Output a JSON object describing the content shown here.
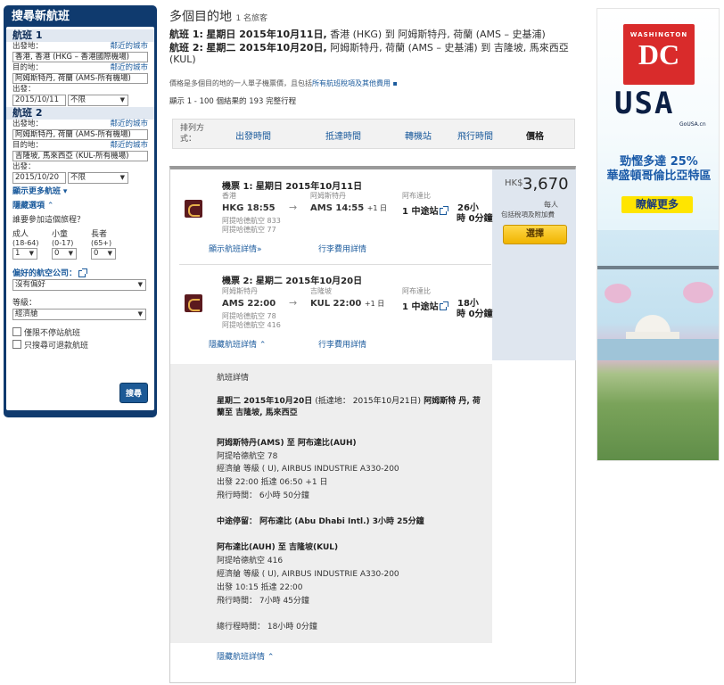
{
  "sidebar": {
    "title": "搜尋新航班",
    "flight1": {
      "header": "航班 1",
      "from_label": "出發地：",
      "from_nearby": "鄰近的城市",
      "from_value": "香港, 香港 (HKG – 香港國際機場)",
      "to_label": "目的地：",
      "to_nearby": "鄰近的城市",
      "to_value": "阿姆斯特丹, 荷蘭 (AMS-所有機場)",
      "depart_label": "出發：",
      "date": "2015/10/11",
      "time": "不限"
    },
    "flight2": {
      "header": "航班 2",
      "from_label": "出發地：",
      "from_nearby": "鄰近的城市",
      "from_value": "阿姆斯特丹, 荷蘭 (AMS-所有機場)",
      "to_label": "目的地：",
      "to_nearby": "鄰近的城市",
      "to_value": "吉隆坡, 馬來西亞 (KUL-所有機場)",
      "depart_label": "出發：",
      "date": "2015/10/20",
      "time": "不限"
    },
    "more_flights": "顯示更多航班",
    "hide_options": "隱藏選項",
    "travelers_q": "誰要參加這個旅程？",
    "adult_label": "成人",
    "adult_range": "(18-64)",
    "adult_value": "1",
    "child_label": "小童",
    "child_range": "(0-17)",
    "child_value": "0",
    "senior_label": "長者",
    "senior_range": "(65+)",
    "senior_value": "0",
    "airline_label": "偏好的航空公司：",
    "airline_value": "沒有偏好",
    "class_label": "等級：",
    "class_value": "經濟艙",
    "nonstop_label": "僅限不停站航班",
    "refundable_label": "只搜尋可退款航班",
    "search_button": "搜尋"
  },
  "header": {
    "title": "多個目的地",
    "travelers": "1 名旅客",
    "route1_prefix": "航班 1:",
    "route1_date": "星期日 2015年10月11日,",
    "route1_text": "香港 (HKG) 到 阿姆斯特丹, 荷蘭 (AMS – 史基浦)",
    "route2_prefix": "航班 2:",
    "route2_date": "星期二 2015年10月20日,",
    "route2_text": "阿姆斯特丹, 荷蘭 (AMS – 史基浦) 到 吉隆坡, 馬來西亞 (KUL)",
    "price_note": "價格是多個目的地的一人單子機票價，且包括",
    "price_note_link": "所有航班稅項及其他費用",
    "results": "顯示 1 - 100 個結果的 193 完整行程"
  },
  "sortbar": {
    "label": "排列方式：",
    "depart": "出發時間",
    "arrive": "抵達時間",
    "stops": "轉機站",
    "duration": "飛行時間",
    "price": "價格"
  },
  "result": {
    "currency": "HK$",
    "price": "3,670",
    "per_person": "每人",
    "includes": "包括稅項及附加費",
    "select": "選擇",
    "leg1": {
      "title": "機票 1: 星期日 2015年10月11日",
      "from_city": "香港",
      "to_city": "阿姆斯特丹",
      "via_city": "阿布達比",
      "dep": "HKG  18:55",
      "arr": "AMS  14:55",
      "arr_plus": "+1 日",
      "stops": "1 中途站",
      "dur1": "26小",
      "dur2": "時 0分鐘",
      "airline1": "阿提哈德航空 833",
      "airline2": "阿提哈德航空 77",
      "details_link": "顯示航班詳情",
      "fees_link": "行李費用詳情"
    },
    "leg2": {
      "title": "機票 2: 星期二 2015年10月20日",
      "from_city": "阿姆斯特丹",
      "to_city": "吉隆坡",
      "via_city": "阿布達比",
      "dep": "AMS  22:00",
      "arr": "KUL  22:00",
      "arr_plus": "+1 日",
      "stops": "1 中途站",
      "dur1": "18小",
      "dur2": "時 0分鐘",
      "airline1": "阿提哈德航空 78",
      "airline2": "阿提哈德航空 416",
      "details_link": "隱藏航班詳情",
      "fees_link": "行李費用詳情"
    },
    "detail": {
      "heading": "航班詳情",
      "summary1": "星期二 2015年10月20日",
      "summary1b": "(抵達地： 2015年10月21日)",
      "summary1c": "阿姆斯特",
      "summary2": "丹, 荷蘭至 吉隆坡, 馬來西亞",
      "seg1_title": "阿姆斯特丹(AMS) 至 阿布達比(AUH)",
      "seg1_flight": "阿提哈德航空 78",
      "seg1_class": "經濟艙 等級 ( U), AIRBUS INDUSTRIE A330-200",
      "seg1_times": "出發 22:00  抵達 06:50 +1 日",
      "seg1_duration": "飛行時間： 6小時 50分鐘",
      "stopover": "中途停留： 阿布達比 (Abu Dhabi Intl.) 3小時 25分鐘",
      "seg2_title": "阿布達比(AUH) 至 吉隆坡(KUL)",
      "seg2_flight": "阿提哈德航空 416",
      "seg2_class": "經濟艙 等級 ( U), AIRBUS INDUSTRIE A330-200",
      "seg2_times": "出發 10:15  抵達 22:00",
      "seg2_duration": "飛行時間： 7小時 45分鐘",
      "total": "總行程時間： 18小時 0分鐘",
      "hide_link": "隱藏航班詳情"
    }
  },
  "ad": {
    "washington": "WASHINGTON",
    "dc": "DC",
    "usa": "USA",
    "usa_sub": "GoUSA.cn",
    "line1": "勁慳多達  25%",
    "line2": "華盛頓哥倫比亞特區",
    "button": "瞭解更多"
  }
}
